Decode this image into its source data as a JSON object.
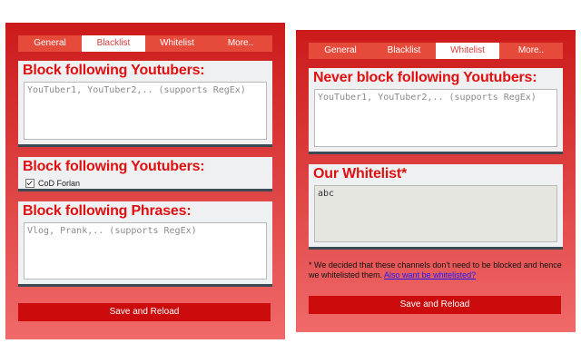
{
  "left": {
    "tabs": [
      {
        "label": "General",
        "active": false
      },
      {
        "label": "Blacklist",
        "active": true
      },
      {
        "label": "Whitelist",
        "active": false
      },
      {
        "label": "More..",
        "active": false
      }
    ],
    "block_youtubers": {
      "title": "Block following Youtubers:",
      "placeholder": "YouTuber1, YouTuber2,.. (supports RegEx)"
    },
    "blocked_list": {
      "title": "Block following Youtubers:",
      "items": [
        {
          "label": "CoD Forlan",
          "checked": true
        }
      ]
    },
    "block_phrases": {
      "title": "Block following Phrases:",
      "placeholder": "Vlog, Prank,.. (supports RegEx)"
    },
    "save_label": "Save and Reload"
  },
  "right": {
    "tabs": [
      {
        "label": "General",
        "active": false
      },
      {
        "label": "Blacklist",
        "active": false
      },
      {
        "label": "Whitelist",
        "active": true
      },
      {
        "label": "More..",
        "active": false
      }
    ],
    "never_block": {
      "title": "Never block following Youtubers:",
      "placeholder": "YouTuber1, YouTuber2,.. (supports RegEx)"
    },
    "our_whitelist": {
      "title": "Our Whitelist*",
      "value": "abc"
    },
    "note_text": "* We decided that these channels don't need to be blocked and hence we whitelisted them. ",
    "note_link": "Also want be whitelisted?",
    "save_label": "Save and Reload"
  },
  "colors": {
    "accent": "#e01010",
    "tab_bg": "#e64a3a",
    "button_bg": "#cc0c0c",
    "card_bg": "#eef0f2",
    "card_border": "#3c4a56"
  }
}
